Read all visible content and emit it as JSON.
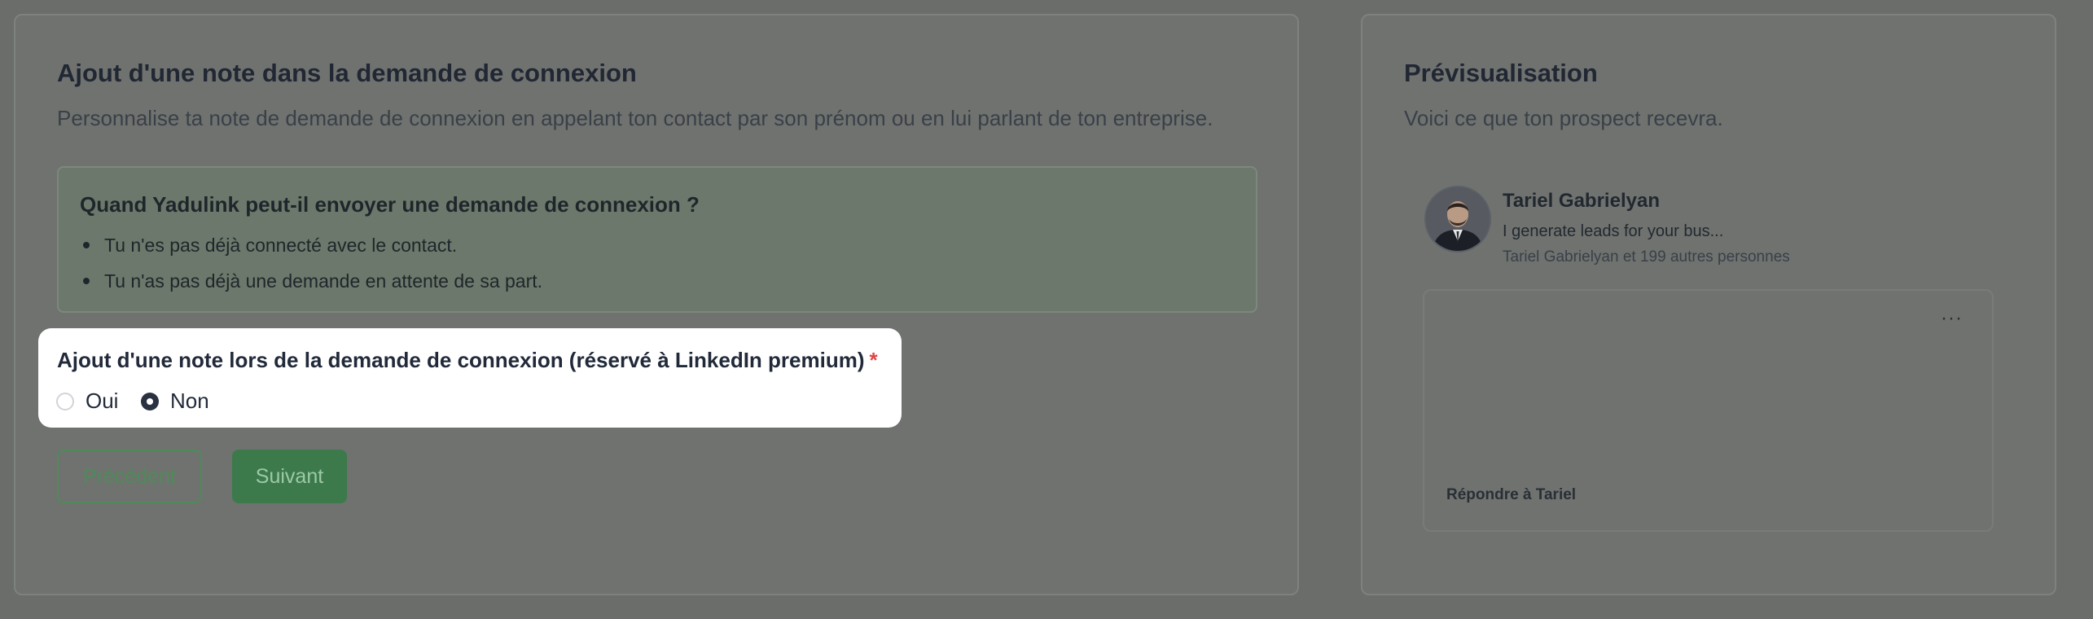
{
  "left_card": {
    "title": "Ajout d'une note dans la demande de connexion",
    "subtitle": "Personnalise ta note de demande de connexion en appelant ton contact par son prénom ou en lui parlant de ton entreprise.",
    "info": {
      "title": "Quand Yadulink peut-il envoyer une demande de connexion ?",
      "bullets": [
        "Tu n'es pas déjà connecté avec le contact.",
        "Tu n'as pas déjà une demande en attente de sa part."
      ]
    },
    "question": {
      "label": "Ajout d'une note lors de la demande de connexion (réservé à LinkedIn premium)",
      "required_mark": "*",
      "options": [
        "Oui",
        "Non"
      ],
      "selected": "Non"
    },
    "buttons": {
      "previous": "Précédent",
      "next": "Suivant"
    }
  },
  "right_card": {
    "title": "Prévisualisation",
    "subtitle": "Voici ce que ton prospect recevra.",
    "profile": {
      "name": "Tariel Gabrielyan",
      "headline": "I generate leads for your bus...",
      "connections": "Tariel Gabrielyan et 199 autres personnes"
    },
    "message": {
      "more_label": "···",
      "reply_label": "Répondre à Tariel"
    }
  },
  "colors": {
    "accent_green": "#3d7a4b",
    "required_red": "#e04444"
  }
}
